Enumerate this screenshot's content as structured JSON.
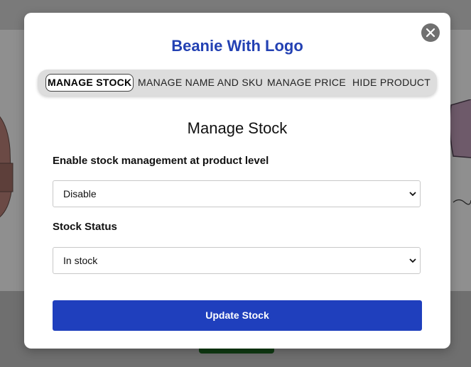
{
  "modal": {
    "title": "Beanie With Logo",
    "tabs": [
      {
        "label": "MANAGE STOCK",
        "active": true
      },
      {
        "label": "MANAGE NAME AND SKU",
        "active": false
      },
      {
        "label": "MANAGE PRICE",
        "active": false
      },
      {
        "label": "HIDE PRODUCT",
        "active": false
      }
    ],
    "section_title": "Manage Stock",
    "stock_management": {
      "label": "Enable stock management at product level",
      "value": "Disable"
    },
    "stock_status": {
      "label": "Stock Status",
      "value": "In stock"
    },
    "update_button": "Update Stock"
  },
  "colors": {
    "title": "#2341b3",
    "button": "#1f3fbd",
    "close": "#707070"
  },
  "icons": {
    "close": "close-icon",
    "dropdown": "chevron-down-icon"
  }
}
